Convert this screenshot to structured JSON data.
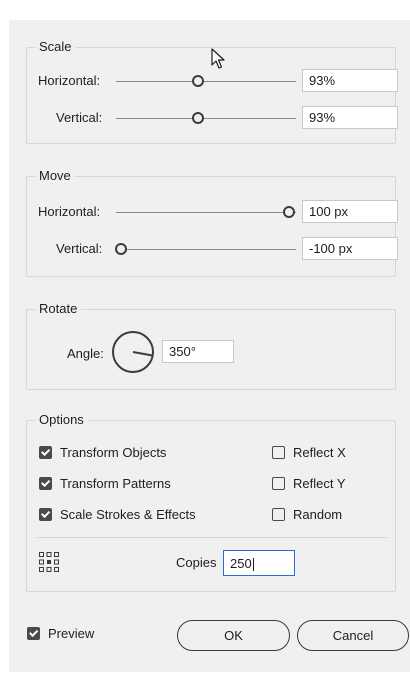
{
  "scale": {
    "legend": "Scale",
    "horizontal_label": "Horizontal:",
    "horizontal_value": "93%",
    "vertical_label": "Vertical:",
    "vertical_value": "93%"
  },
  "move": {
    "legend": "Move",
    "horizontal_label": "Horizontal:",
    "horizontal_value": "100 px",
    "vertical_label": "Vertical:",
    "vertical_value": "-100 px"
  },
  "rotate": {
    "legend": "Rotate",
    "angle_label": "Angle:",
    "angle_value": "350°"
  },
  "options": {
    "legend": "Options",
    "transform_objects": {
      "label": "Transform Objects",
      "checked": true
    },
    "transform_patterns": {
      "label": "Transform Patterns",
      "checked": true
    },
    "scale_strokes": {
      "label": "Scale Strokes & Effects",
      "checked": true
    },
    "reflect_x": {
      "label": "Reflect X",
      "checked": false
    },
    "reflect_y": {
      "label": "Reflect Y",
      "checked": false
    },
    "random": {
      "label": "Random",
      "checked": false
    },
    "reference_point_icon": "reference-point-grid-icon",
    "copies_label": "Copies",
    "copies_value": "250"
  },
  "footer": {
    "preview": {
      "label": "Preview",
      "checked": true
    },
    "ok_label": "OK",
    "cancel_label": "Cancel"
  },
  "colors": {
    "background": "#f0f0f0",
    "focus": "#2c6bd6"
  }
}
